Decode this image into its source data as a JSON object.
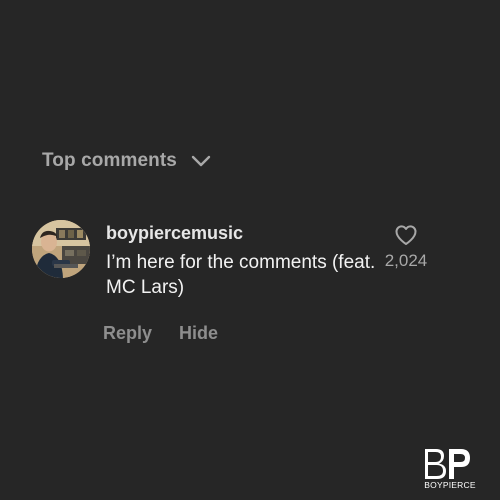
{
  "section": {
    "title": "Top comments",
    "toggle_icon": "chevron-down-icon"
  },
  "comment": {
    "username": "boypiercemusic",
    "text": "I’m here for the comments (feat. MC Lars)",
    "likes": "2,024",
    "like_icon": "heart-outline-icon",
    "avatar": "user-avatar-photo"
  },
  "actions": {
    "reply_label": "Reply",
    "hide_label": "Hide"
  },
  "logo": {
    "monogram": "BP",
    "text": "BOYPIERCE"
  },
  "colors": {
    "background": "#262626",
    "primary_text": "#f2f2f2",
    "secondary_text": "#a8a8a8",
    "action_text": "#8e8e8e"
  }
}
